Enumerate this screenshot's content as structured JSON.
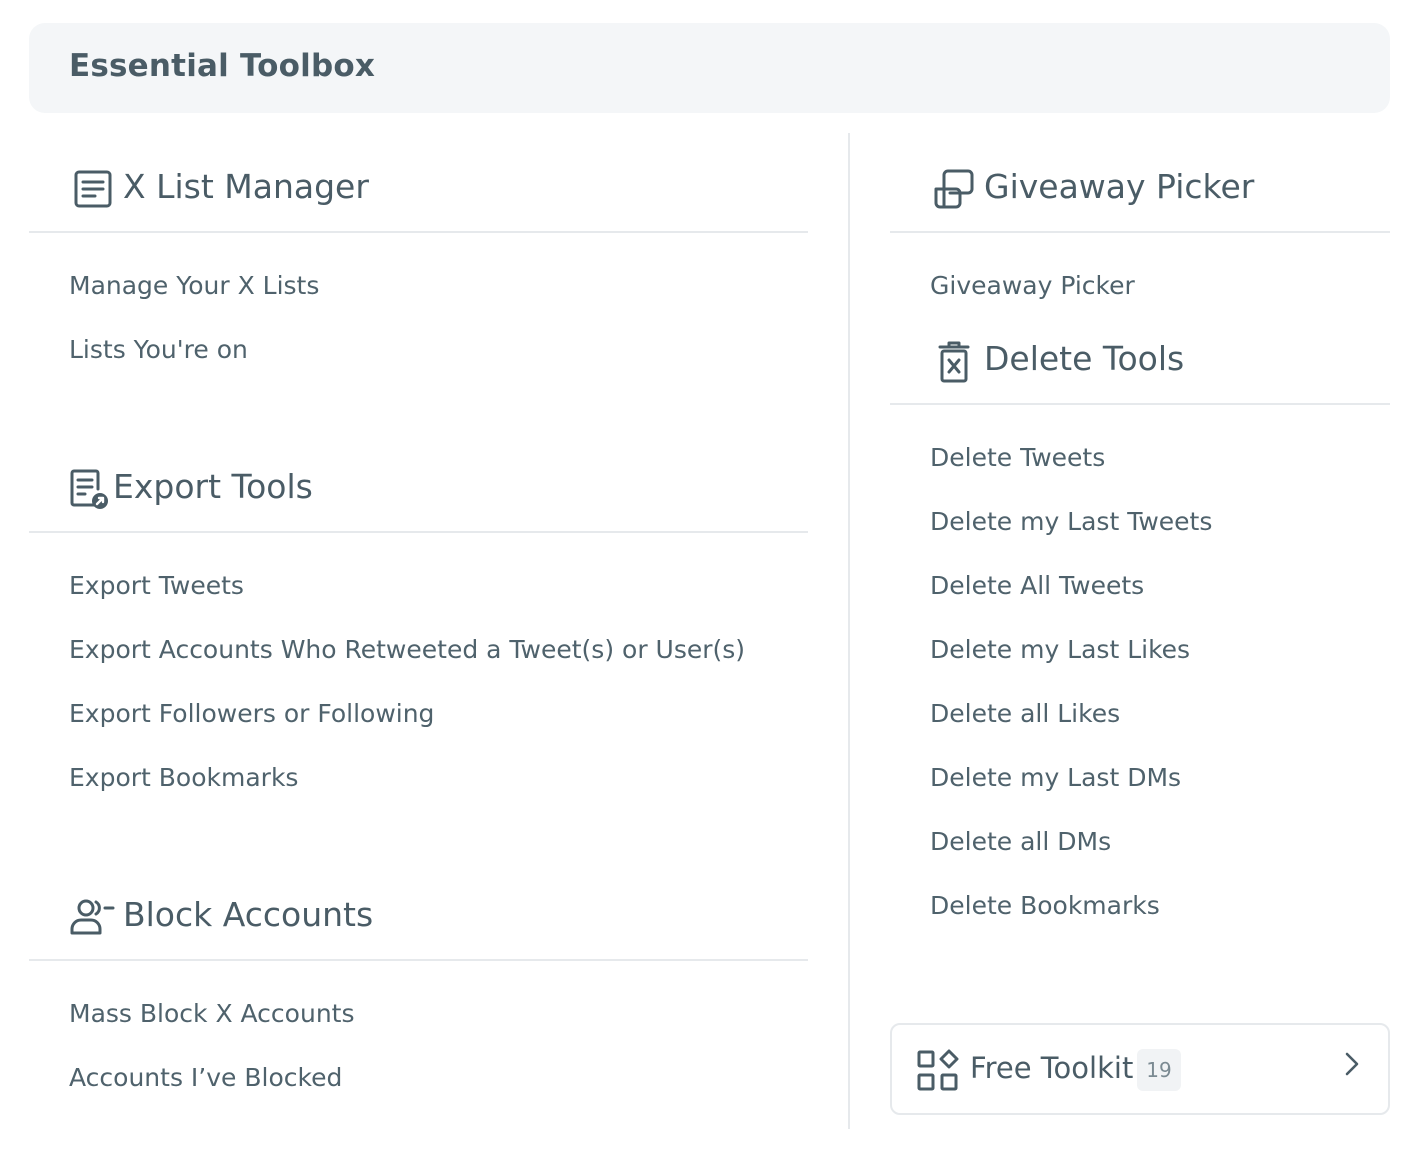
{
  "header": {
    "title": "Essential Toolbox"
  },
  "left": [
    {
      "icon": "list-icon",
      "title": "X List Manager",
      "items": [
        "Manage Your X Lists",
        "Lists You're on"
      ]
    },
    {
      "icon": "export-icon",
      "title": "Export Tools",
      "items": [
        "Export Tweets",
        "Export Accounts Who Retweeted a Tweet(s) or User(s)",
        "Export Followers or Following",
        "Export Bookmarks"
      ]
    },
    {
      "icon": "user-block-icon",
      "title": "Block Accounts",
      "items": [
        "Mass Block X Accounts",
        "Accounts I’ve Blocked"
      ]
    }
  ],
  "right": [
    {
      "icon": "giveaway-icon",
      "title": "Giveaway Picker",
      "items": [
        "Giveaway Picker"
      ]
    },
    {
      "icon": "trash-icon",
      "title": "Delete Tools",
      "items": [
        "Delete Tweets",
        "Delete my Last Tweets",
        "Delete All Tweets",
        "Delete my Last Likes",
        "Delete all Likes",
        "Delete my Last DMs",
        "Delete all DMs",
        "Delete Bookmarks"
      ]
    }
  ],
  "toolkit": {
    "icon": "apps-icon",
    "label": "Free Toolkit",
    "count": "19"
  }
}
